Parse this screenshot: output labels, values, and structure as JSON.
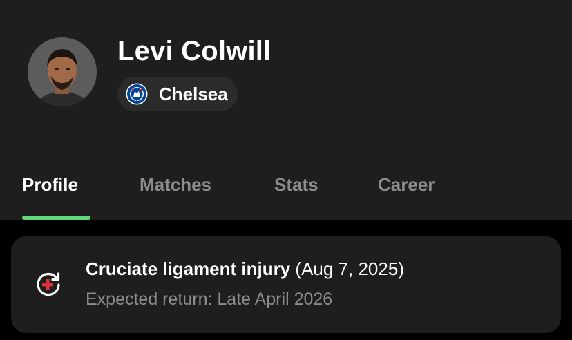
{
  "player": {
    "name": "Levi Colwill",
    "team": "Chelsea"
  },
  "tabs": [
    {
      "label": "Profile",
      "active": true
    },
    {
      "label": "Matches",
      "active": false
    },
    {
      "label": "Stats",
      "active": false
    },
    {
      "label": "Career",
      "active": false
    }
  ],
  "injury": {
    "type": "Cruciate ligament injury",
    "date": "(Aug 7, 2025)",
    "expected_return": "Expected return: Late April 2026",
    "icon": "injury-return-icon"
  },
  "colors": {
    "background": "#000000",
    "surface": "#1e1e1e",
    "pill": "#2b2b2b",
    "accent": "#63d67a",
    "injury_red": "#e0303a",
    "muted_text": "#8c8c8c",
    "team_blue": "#034694"
  }
}
